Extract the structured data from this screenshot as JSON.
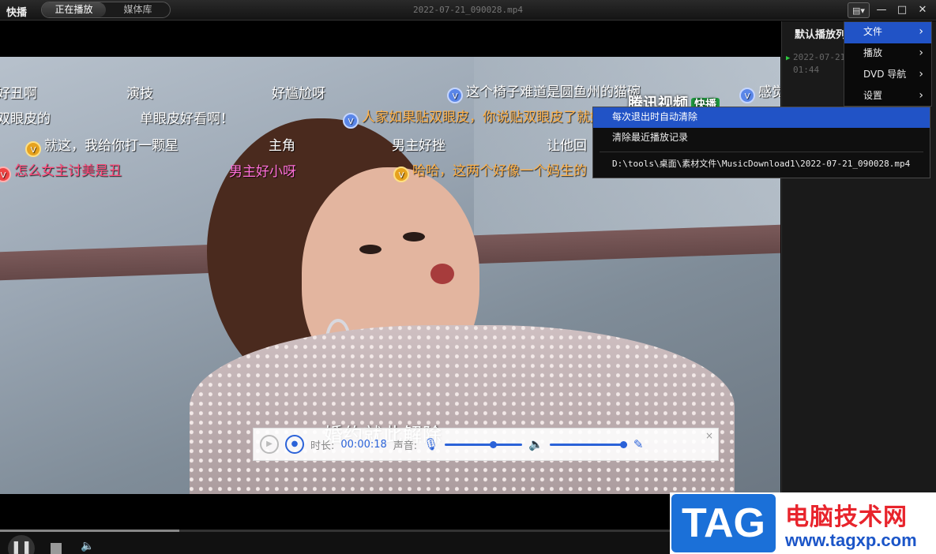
{
  "app": {
    "name": "快播",
    "file_title": "2022-07-21_090028.mp4"
  },
  "tabs": [
    {
      "label": "正在播放",
      "active": true
    },
    {
      "label": "媒体库",
      "active": false
    }
  ],
  "window_controls": {
    "menu": "▤▾",
    "minimize": "—",
    "maximize": "□",
    "close": "✕"
  },
  "danmu": [
    {
      "text": "好丑啊",
      "style": "white"
    },
    {
      "text": "演技",
      "style": "white"
    },
    {
      "text": "好尴尬呀",
      "style": "white"
    },
    {
      "text": "这个椅子难道是圆鱼州的猫碗",
      "style": "white",
      "badge": "blue"
    },
    {
      "text": "感觉",
      "style": "white",
      "badge": "blue"
    },
    {
      "text": "双眼皮的",
      "style": "white"
    },
    {
      "text": "单眼皮好看啊！",
      "style": "white"
    },
    {
      "text": "人家如果贴双眼皮，你说贴双眼皮了就好",
      "style": "orange",
      "badge": "blue"
    },
    {
      "text": "就这，我给你打一颗星",
      "style": "white",
      "badge": "gold"
    },
    {
      "text": "主角",
      "style": "white"
    },
    {
      "text": "男主好挫",
      "style": "white"
    },
    {
      "text": "让他回",
      "style": "white"
    },
    {
      "text": "怎么女主讨美是丑",
      "style": "red",
      "badge": "red"
    },
    {
      "text": "男主好小呀",
      "style": "pink"
    },
    {
      "text": "哈哈，这两个好像一个妈生的",
      "style": "orange",
      "badge": "gold"
    }
  ],
  "watermark_logo": {
    "name": "腾讯视频",
    "tag": "快播"
  },
  "subtitle": "婚约就此解除",
  "recorder": {
    "duration_label": "时长:",
    "duration_value": "00:00:18",
    "sound_label": "声音:",
    "mic_level": 0.62,
    "speaker_level": 0.95,
    "close": "×"
  },
  "playlist": {
    "title": "默认播放列",
    "item_line1": "2022-07-21_",
    "item_line2": "01:44"
  },
  "main_menu": [
    {
      "label": "文件",
      "active": true
    },
    {
      "label": "播放",
      "active": false
    },
    {
      "label": "DVD 导航",
      "active": false
    },
    {
      "label": "设置",
      "active": false
    }
  ],
  "file_submenu": {
    "items": [
      {
        "label": "每次退出时自动清除",
        "active": true
      },
      {
        "label": "清除最近播放记录",
        "active": false
      }
    ],
    "recent_path": "D:\\tools\\桌面\\素材文件\\MusicDownload1\\2022-07-21_090028.mp4"
  },
  "playback": {
    "progress": 0.23
  },
  "site_watermark": {
    "tag": "TAG",
    "cn": "电脑技术网",
    "url": "www.tagxp.com"
  },
  "colors": {
    "menu_highlight": "#2153c6",
    "accent": "#2b62d8",
    "watermark_red": "#e8242c"
  }
}
